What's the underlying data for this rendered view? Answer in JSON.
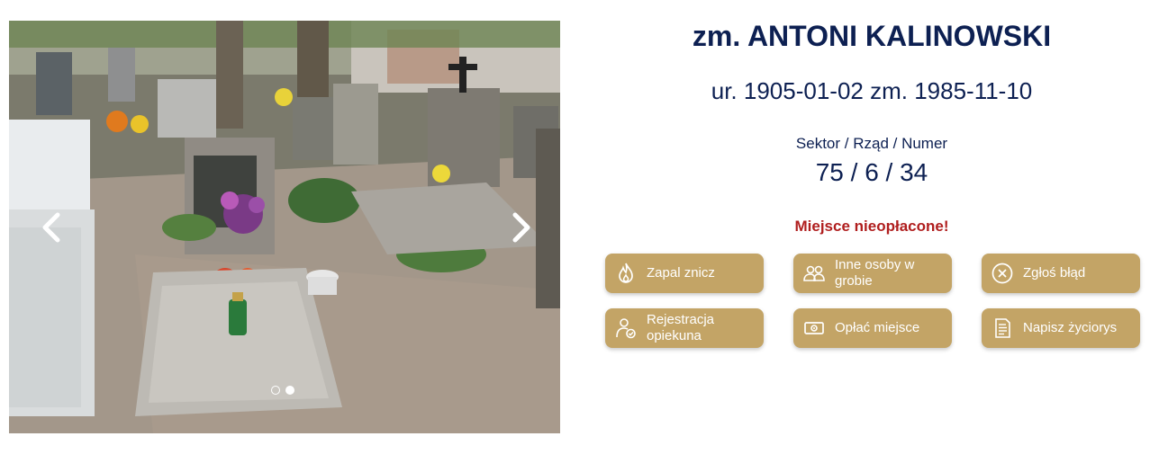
{
  "deceased": {
    "name": "zm. ANTONI KALINOWSKI",
    "dates": "ur. 1905-01-02 zm. 1985-11-10"
  },
  "location": {
    "label": "Sektor / Rząd / Numer",
    "value": "75 / 6 / 34"
  },
  "payment_status": "Miejsce nieopłacone!",
  "actions": [
    {
      "label": "Zapal znicz",
      "icon": "flame-icon"
    },
    {
      "label": "Inne osoby w grobie",
      "icon": "people-icon"
    },
    {
      "label": "Zgłoś błąd",
      "icon": "error-x-icon"
    },
    {
      "label": "Rejestracja opiekuna",
      "icon": "caretaker-icon"
    },
    {
      "label": "Opłać miejsce",
      "icon": "banknote-icon"
    },
    {
      "label": "Napisz życiorys",
      "icon": "document-icon"
    }
  ],
  "carousel": {
    "slides_count": 2,
    "active_slide": 2
  },
  "colors": {
    "title": "#0d2052",
    "warning": "#b01e1e",
    "button_bg": "#c3a466",
    "button_text": "#ffffff"
  }
}
